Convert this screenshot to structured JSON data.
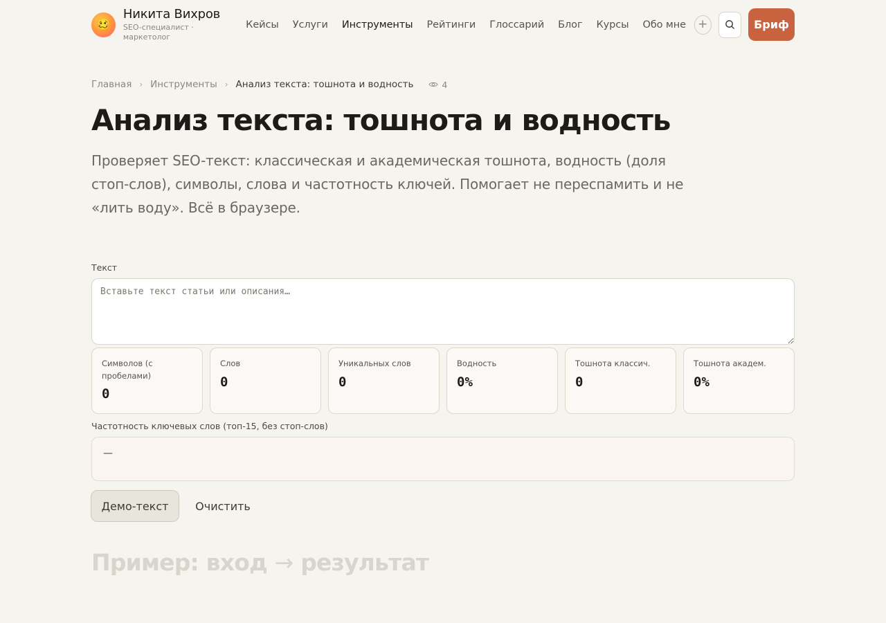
{
  "header": {
    "brand_name": "Никита Вихров",
    "brand_sub": "SEO-специалист · маркетолог",
    "avatar_emoji": "🥴",
    "nav": [
      {
        "label": "Кейсы",
        "active": false
      },
      {
        "label": "Услуги",
        "active": false
      },
      {
        "label": "Инструменты",
        "active": true
      },
      {
        "label": "Рейтинги",
        "active": false
      },
      {
        "label": "Глоссарий",
        "active": false
      },
      {
        "label": "Блог",
        "active": false
      },
      {
        "label": "Курсы",
        "active": false
      },
      {
        "label": "Обо мне",
        "active": false
      }
    ],
    "plus_label": "+",
    "brief_label": "Бриф"
  },
  "breadcrumb": {
    "items": [
      "Главная",
      "Инструменты",
      "Анализ текста: тошнота и водность"
    ],
    "separator": "›",
    "views": "4"
  },
  "page": {
    "title": "Анализ текста: тошнота и водность",
    "description": "Проверяет SEO-текст: классическая и академическая тошнота, водность (доля стоп-слов), символы, слова и частотность ключей. Помогает не переспамить и не «лить воду». Всё в браузере."
  },
  "tool": {
    "text_label": "Текст",
    "text_placeholder": "Вставьте текст статьи или описания…",
    "text_value": "",
    "stats": [
      {
        "label": "Символов (с пробелами)",
        "value": "0"
      },
      {
        "label": "Слов",
        "value": "0"
      },
      {
        "label": "Уникальных слов",
        "value": "0"
      },
      {
        "label": "Водность",
        "value": "0%"
      },
      {
        "label": "Тошнота классич.",
        "value": "0"
      },
      {
        "label": "Тошнота академ.",
        "value": "0%"
      }
    ],
    "freq_label": "Частотность ключевых слов (топ-15, без стоп-слов)",
    "freq_value": "—",
    "demo_button": "Демо-текст",
    "clear_button": "Очистить"
  },
  "example": {
    "title_left": "Пример: вход",
    "arrow": "→",
    "title_right": "результат"
  },
  "colors": {
    "background": "#f5f4ee",
    "accent": "#c9623f",
    "text": "#1c1b18",
    "muted": "#8b877e"
  },
  "icons": [
    "search-icon",
    "eye-icon",
    "plus-icon"
  ]
}
